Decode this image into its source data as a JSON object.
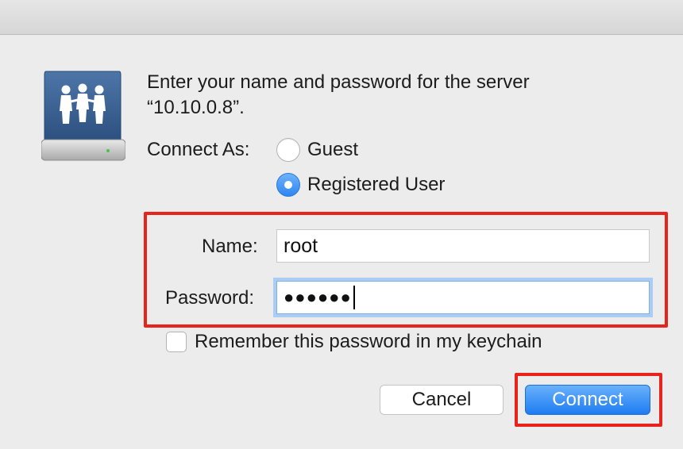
{
  "dialog": {
    "prompt_line1": "Enter your name and password for the server",
    "prompt_line2": "“10.10.0.8”.",
    "connect_as_label": "Connect As:",
    "options": [
      {
        "label": "Guest",
        "selected": false
      },
      {
        "label": "Registered User",
        "selected": true
      }
    ],
    "name_label": "Name:",
    "name_value": "root",
    "password_label": "Password:",
    "password_value": "●●●●●●",
    "remember_label": "Remember this password in my keychain",
    "remember_checked": false,
    "cancel_label": "Cancel",
    "connect_label": "Connect"
  },
  "colors": {
    "accent": "#2f86f0",
    "annotation": "#e8231c",
    "background": "#ececec"
  },
  "icons": {
    "server": "shared-server-icon"
  }
}
